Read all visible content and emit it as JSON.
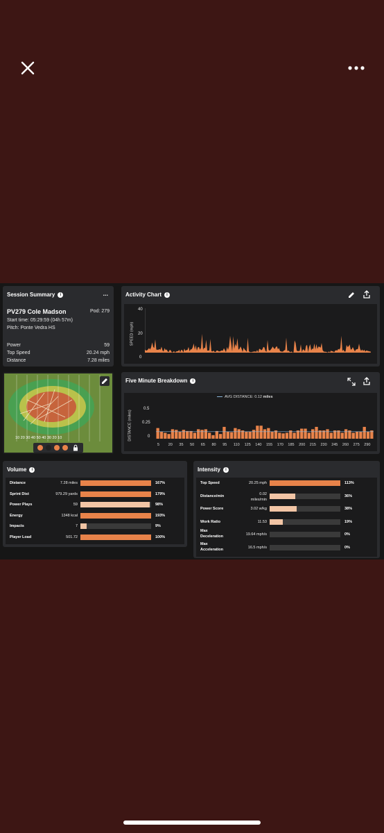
{
  "colors": {
    "accent": "#e8834a",
    "light": "#f2c5a5",
    "track": "#3a3a3a",
    "bg": "#3d1614"
  },
  "viewer": {
    "close_icon": "close-icon",
    "more_icon": "more-icon"
  },
  "summary": {
    "title": "Session Summary",
    "menu": "...",
    "player": "PV279 Cole Madson",
    "pod": "Pod: 279",
    "start": "Start time: 05:29:59 (04h 57m)",
    "pitch": "Pitch: Ponte Vedra HS",
    "stats": [
      {
        "label": "Power",
        "value": "59"
      },
      {
        "label": "Top Speed",
        "value": "20.24 mph"
      },
      {
        "label": "Distance",
        "value": "7.28 miles"
      }
    ]
  },
  "activity": {
    "title": "Activity Chart",
    "y_label": "SPEED (mph)",
    "ticks": [
      "40",
      "20",
      "0"
    ]
  },
  "breakdown": {
    "title": "Five Minute Breakdown",
    "legend_label": "AVG DISTANCE: 0.12",
    "legend_unit": "miles",
    "y_label": "DISTANCE (miles)",
    "y_ticks": [
      "0.5",
      "0.25",
      "0"
    ],
    "x_ticks": [
      "5",
      "20",
      "35",
      "50",
      "65",
      "80",
      "95",
      "110",
      "125",
      "140",
      "155",
      "170",
      "185",
      "200",
      "215",
      "230",
      "245",
      "260",
      "275",
      "290"
    ]
  },
  "chart_data": {
    "type": "bar",
    "categories": [
      "5",
      "10",
      "15",
      "20",
      "25",
      "30",
      "35",
      "40",
      "45",
      "50",
      "55",
      "60",
      "65",
      "70",
      "75",
      "80",
      "85",
      "90",
      "95",
      "100",
      "105",
      "110",
      "115",
      "120",
      "125",
      "130",
      "135",
      "140",
      "145",
      "150",
      "155",
      "160",
      "165",
      "170",
      "175",
      "180",
      "185",
      "190",
      "195",
      "200",
      "205",
      "210",
      "215",
      "220",
      "225",
      "230",
      "235",
      "240",
      "245",
      "250",
      "255",
      "260",
      "265",
      "270",
      "275",
      "280",
      "285",
      "290",
      "295"
    ],
    "values": [
      0.18,
      0.12,
      0.1,
      0.08,
      0.16,
      0.15,
      0.12,
      0.15,
      0.13,
      0.13,
      0.1,
      0.16,
      0.15,
      0.16,
      0.1,
      0.06,
      0.13,
      0.08,
      0.2,
      0.12,
      0.11,
      0.18,
      0.16,
      0.14,
      0.12,
      0.12,
      0.15,
      0.22,
      0.22,
      0.16,
      0.18,
      0.12,
      0.14,
      0.1,
      0.09,
      0.1,
      0.14,
      0.1,
      0.14,
      0.17,
      0.17,
      0.1,
      0.16,
      0.2,
      0.14,
      0.14,
      0.16,
      0.1,
      0.14,
      0.14,
      0.1,
      0.16,
      0.14,
      0.1,
      0.12,
      0.12,
      0.2,
      0.12,
      0.14
    ],
    "ylabel": "DISTANCE (miles)",
    "ylim": [
      0,
      0.5
    ]
  },
  "map": {
    "edit_icon": "pencil-icon",
    "lock_icon": "lock-icon",
    "yard_labels": "10 20 30 40 50 40 30 20 10"
  },
  "volume": {
    "title": "Volume",
    "rows": [
      {
        "label": "Distance",
        "value": "7.28 miles",
        "fill": 1.0,
        "pct": "167%",
        "light": false
      },
      {
        "label": "Sprint Dist",
        "value": "979.29 yards",
        "fill": 1.0,
        "pct": "179%",
        "light": false
      },
      {
        "label": "Power Plays",
        "value": "59",
        "fill": 0.98,
        "pct": "98%",
        "light": true
      },
      {
        "label": "Energy",
        "value": "1348 kcal",
        "fill": 1.0,
        "pct": "193%",
        "light": false
      },
      {
        "label": "Impacts",
        "value": "7",
        "fill": 0.09,
        "pct": "9%",
        "light": true
      },
      {
        "label": "Player Load",
        "value": "501.72",
        "fill": 1.0,
        "pct": "100%",
        "light": false
      }
    ]
  },
  "intensity": {
    "title": "Intensity",
    "rows": [
      {
        "label": "Top Speed",
        "label2": "",
        "value": "20.25 mph",
        "value2": "",
        "fill": 1.0,
        "pct": "113%",
        "light": false
      },
      {
        "label": "Distance/min",
        "label2": "",
        "value": "0.02",
        "value2": "miles/min",
        "fill": 0.36,
        "pct": "36%",
        "light": true
      },
      {
        "label": "Power Score",
        "label2": "",
        "value": "3.02 w/kg",
        "value2": "",
        "fill": 0.38,
        "pct": "38%",
        "light": true
      },
      {
        "label": "Work Ratio",
        "label2": "",
        "value": "11.53",
        "value2": "",
        "fill": 0.19,
        "pct": "19%",
        "light": true
      },
      {
        "label": "Max",
        "label2": "Deceleration",
        "value": "19.64 mph/s",
        "value2": "",
        "fill": 0,
        "pct": "0%",
        "light": false
      },
      {
        "label": "Max",
        "label2": "Acceleration",
        "value": "16.5 mph/s",
        "value2": "",
        "fill": 0,
        "pct": "0%",
        "light": false
      }
    ]
  }
}
